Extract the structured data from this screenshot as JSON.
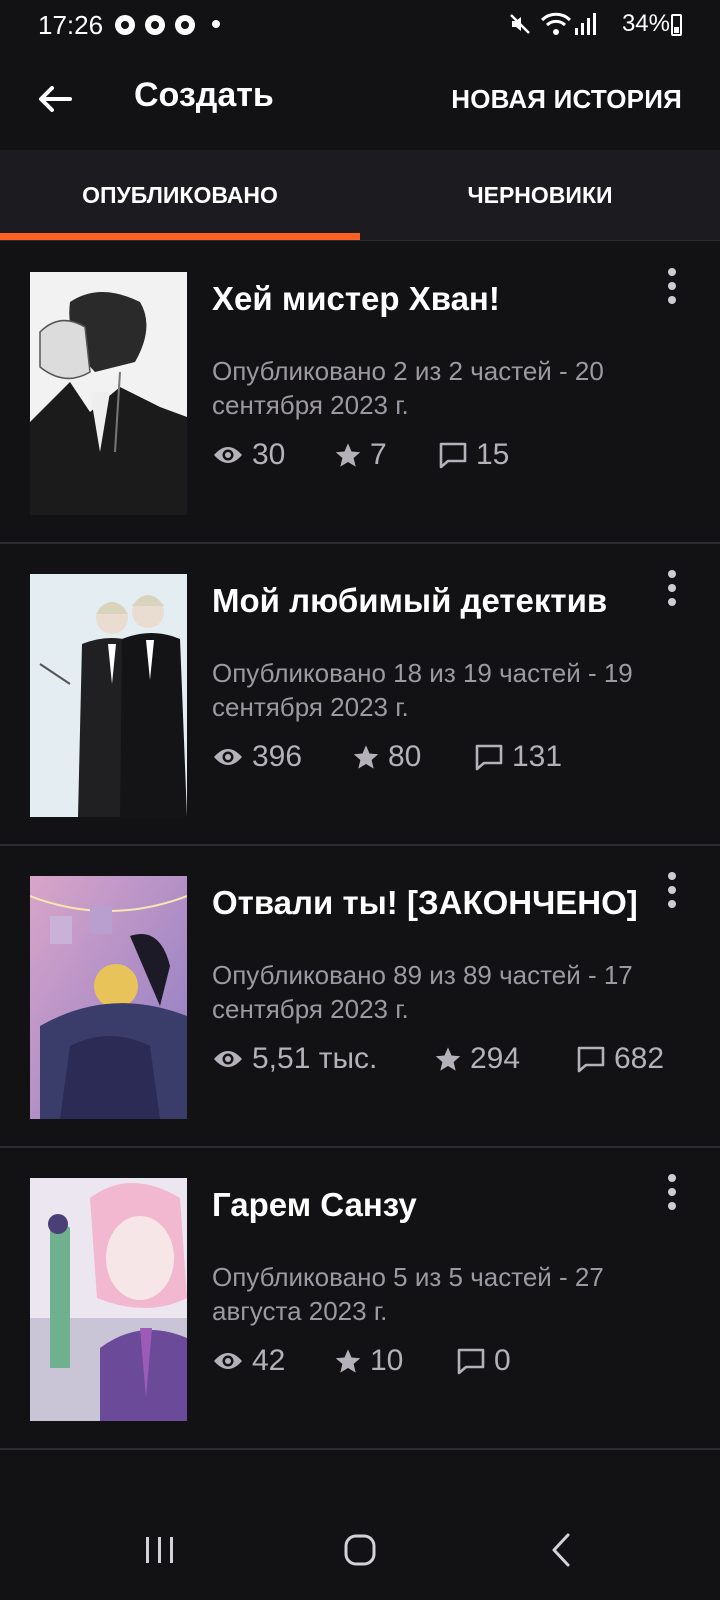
{
  "status": {
    "time": "17:26",
    "battery": "34%",
    "icons": [
      "chrome-icon",
      "chrome-icon",
      "chrome-icon",
      "mute-icon",
      "wifi-icon",
      "signal-icon",
      "battery-icon"
    ]
  },
  "app_bar": {
    "title": "Создать",
    "new_story_label": "НОВАЯ ИСТОРИЯ"
  },
  "tabs": {
    "published": "ОПУБЛИКОВАНО",
    "drafts": "ЧЕРНОВИКИ",
    "accent": "#ff6122"
  },
  "stories": [
    {
      "title": "Хей мистер Хван!",
      "meta": "Опубликовано 2 из 2 частей - 20 сентября 2023 г.",
      "views": "30",
      "votes": "7",
      "comments": "15"
    },
    {
      "title": "Мой любимый детектив",
      "meta": "Опубликовано 18 из 19 частей - 19 сентября 2023 г.",
      "views": "396",
      "votes": "80",
      "comments": "131"
    },
    {
      "title": "Отвали ты! [ЗАКОНЧЕНО]",
      "meta": "Опубликовано 89 из 89 частей - 17 сентября 2023 г.",
      "views": "5,51 тыс.",
      "votes": "294",
      "comments": "682"
    },
    {
      "title": "Гарем Санзу",
      "meta": "Опубликовано 5 из 5 частей - 27 августа 2023 г.",
      "views": "42",
      "votes": "10",
      "comments": "0"
    }
  ]
}
